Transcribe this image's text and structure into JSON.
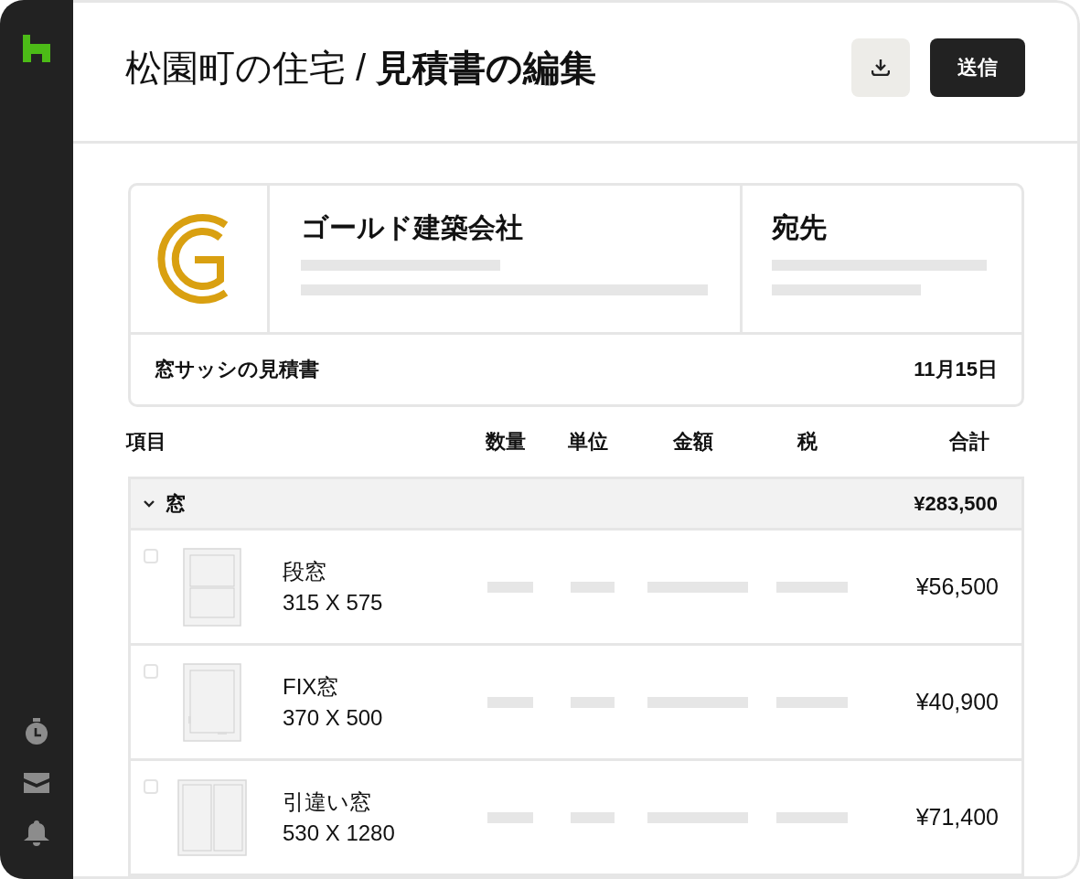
{
  "header": {
    "title": "松園町の住宅 / **見積書の編集**",
    "send_button": "送信"
  },
  "company": {
    "name": "ゴールド建築会社"
  },
  "recipient": {
    "label": "宛先"
  },
  "quote": {
    "title": "窓サッシの見積書",
    "date": "11月15日"
  },
  "table": {
    "columns": [
      "項目",
      "数量",
      "単位",
      "金額",
      "税",
      "合計"
    ],
    "groups": [
      {
        "name": "窓",
        "expanded": true,
        "total": "¥283,500",
        "items": [
          {
            "kind": "hung",
            "name": "段窓",
            "size": "315 X 575",
            "checked": false,
            "total": "¥56,500"
          },
          {
            "kind": "fixed",
            "name": "FIX窓",
            "size": "370 X 500",
            "checked": false,
            "total": "¥40,900"
          },
          {
            "kind": "sliding",
            "name": "引違い窓",
            "size": "530 X 1280",
            "checked": false,
            "total": "¥71,400"
          }
        ]
      }
    ]
  }
}
